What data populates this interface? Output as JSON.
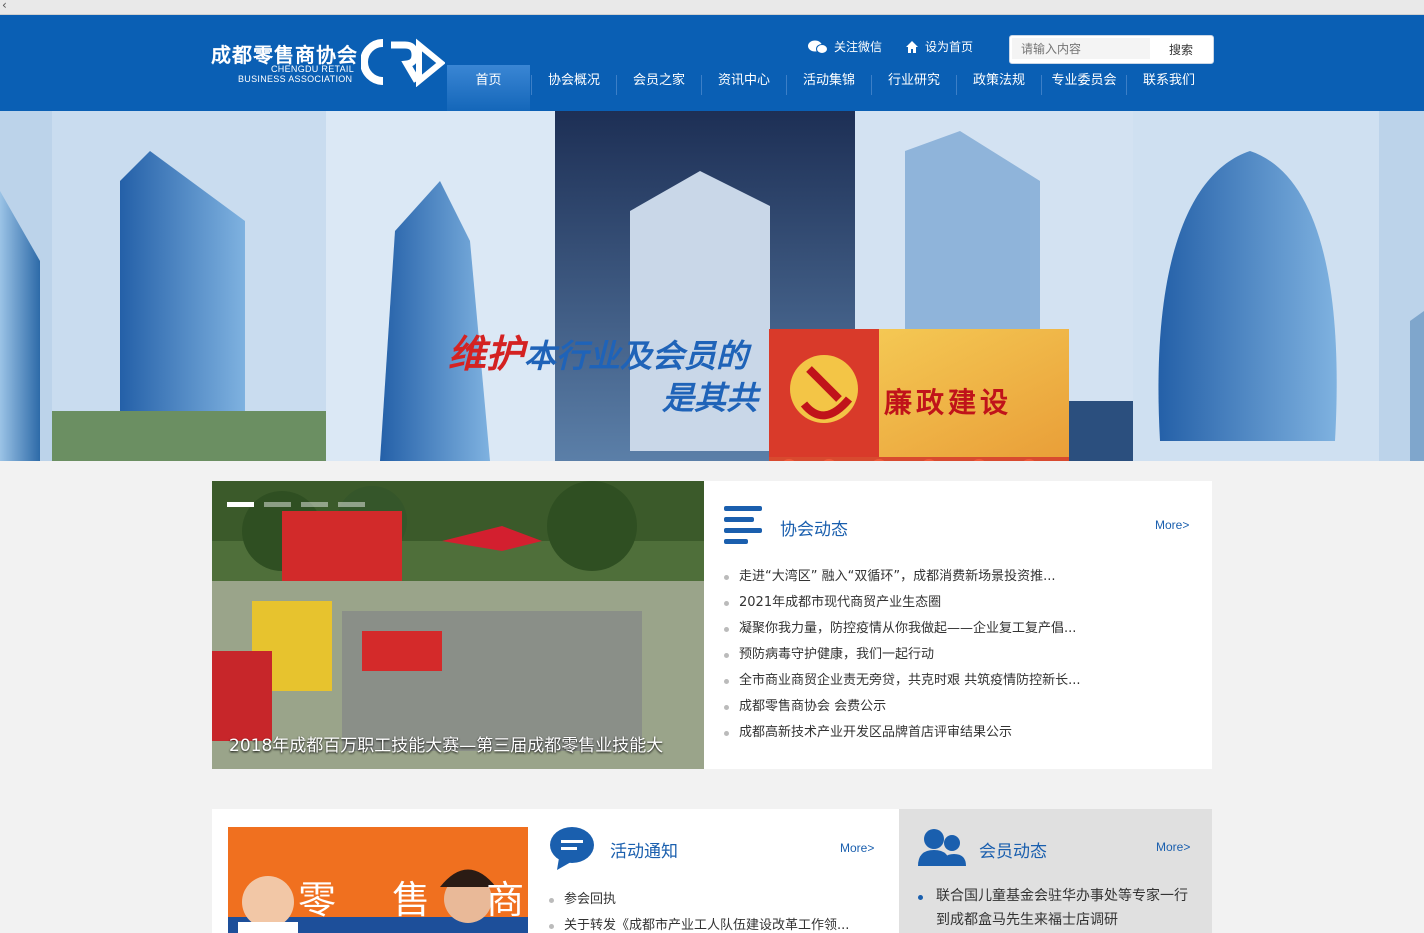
{
  "header": {
    "logo_cn": "成都零售商协会",
    "logo_en_line1": "CHENGDU RETAIL",
    "logo_en_line2": "BUSINESS ASSOCIATION",
    "wechat_label": "关注微信",
    "homepage_label": "设为首页",
    "search_placeholder": "请输入内容",
    "search_button": "搜索",
    "brand_color": "#0a5fb4"
  },
  "nav": {
    "items": [
      "首页",
      "协会概况",
      "会员之家",
      "资讯中心",
      "活动集锦",
      "行业研究",
      "政策法规",
      "专业委员会",
      "联系我们"
    ],
    "active_index": 0
  },
  "banner": {
    "slogan_red": "维护",
    "slogan_blue": "本行业及会员的",
    "slogan_line2": "是其共",
    "inset_title": "廉政建设",
    "slide_count": 3,
    "active_slide": 2
  },
  "featured": {
    "caption": "2018年成都百万职工技能大赛—第三届成都零售业技能大",
    "slide_count": 4,
    "active_slide": 1
  },
  "association_news": {
    "title": "协会动态",
    "more": "More>",
    "items": [
      "走进“大湾区” 融入“双循环”，成都消费新场景投资推...",
      "2021年成都市现代商贸产业生态圈",
      "凝聚你我力量，防控疫情从你我做起——企业复工复产倡...",
      "预防病毒守护健康，我们一起行动",
      "全市商业商贸企业责无旁贷，共克时艰 共筑疫情防控新长...",
      "成都零售商协会 会费公示",
      "成都高新技术产业开发区品牌首店评审结果公示"
    ]
  },
  "activity_notice": {
    "title": "活动通知",
    "more": "More>",
    "photo_text": "零 售 商 协",
    "items": [
      "参会回执",
      "关于转发《成都市产业工人队伍建设改革工作领..."
    ]
  },
  "member_news": {
    "title": "会员动态",
    "more": "More>",
    "items": [
      "联合国儿童基金会驻华办事处等专家一行",
      "到成都盒马先生来福士店调研"
    ]
  }
}
